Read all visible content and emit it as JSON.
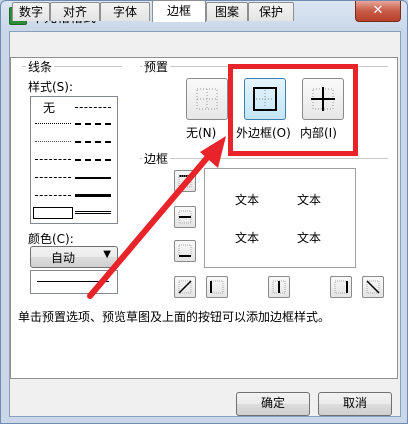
{
  "window": {
    "title": "单元格格式",
    "app_icon_letter": "S",
    "close_glyph": "✕"
  },
  "tabs": [
    {
      "label": "数字"
    },
    {
      "label": "对齐"
    },
    {
      "label": "字体"
    },
    {
      "label": "边框",
      "active": true
    },
    {
      "label": "图案"
    },
    {
      "label": "保护"
    }
  ],
  "lines_group": {
    "title": "线条",
    "style_label": "样式(S):",
    "none_label": "无"
  },
  "color": {
    "label": "颜色(C):",
    "selected": "自动"
  },
  "presets": {
    "title": "预置",
    "items": [
      {
        "label": "无(N)",
        "icon": "border-none-icon"
      },
      {
        "label": "外边框(O)",
        "icon": "border-outline-icon",
        "selected": true
      },
      {
        "label": "内部(I)",
        "icon": "border-inside-icon"
      }
    ]
  },
  "border": {
    "title": "边框",
    "preview_texts": [
      "文本",
      "文本",
      "文本",
      "文本"
    ]
  },
  "hint": "单击预置选项、预览草图及上面的按钮可以添加边框样式。",
  "buttons": {
    "ok": "确定",
    "cancel": "取消"
  },
  "colors": {
    "accent_red": "#e8232a",
    "selected_blue": "#3c7fb1"
  }
}
